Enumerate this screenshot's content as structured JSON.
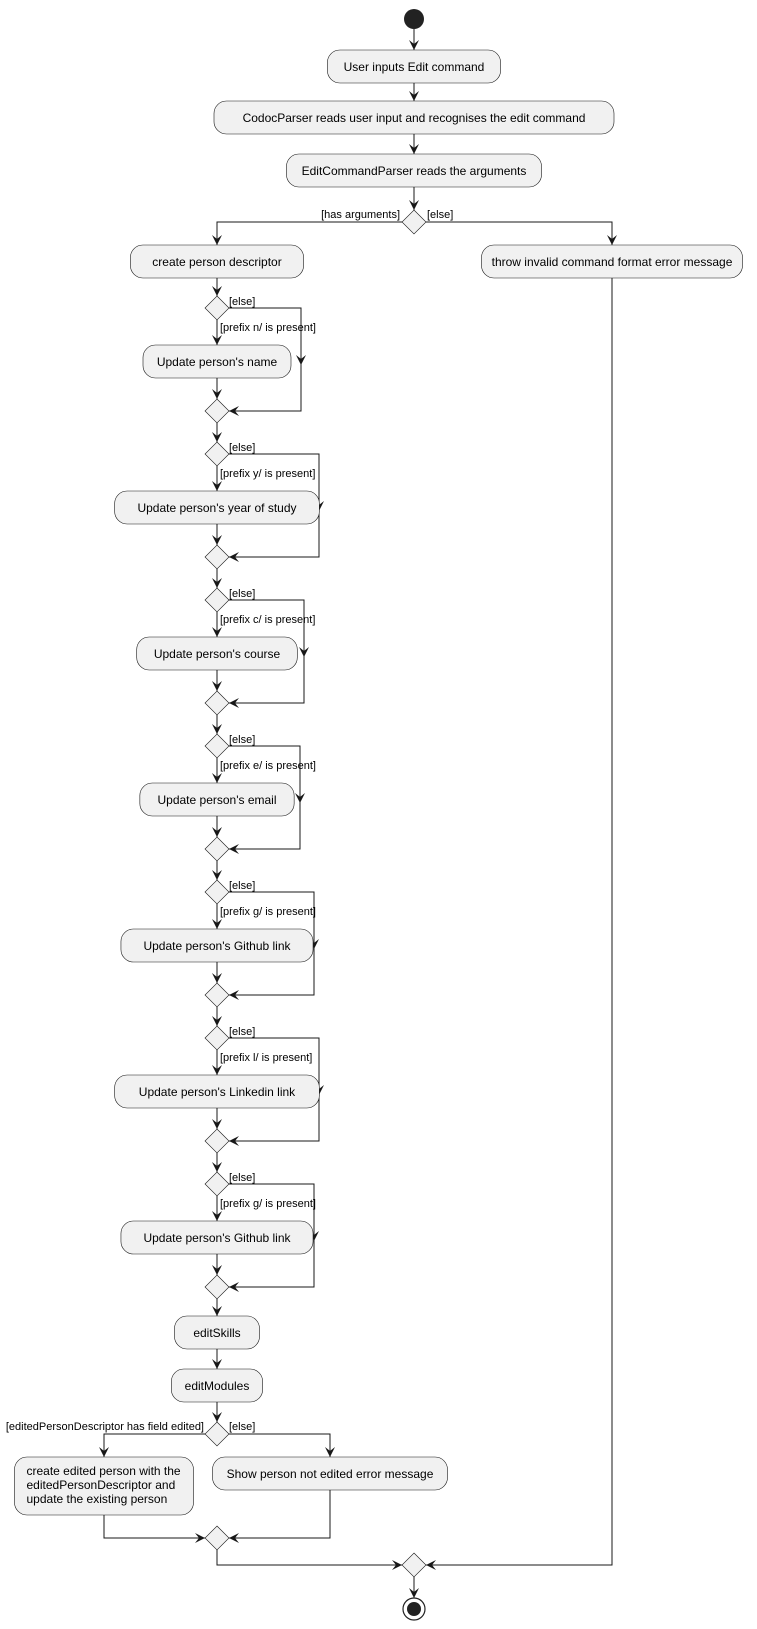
{
  "diagram": {
    "type": "UML activity diagram",
    "start_label": "start",
    "end_label": "stop",
    "actions": {
      "user_input": "User inputs Edit command",
      "codoc_parser": "CodocParser reads user input and recognises the edit command",
      "edit_parser": "EditCommandParser reads the arguments",
      "create_descriptor": "create person descriptor",
      "throw_error": "throw invalid command format error message",
      "edit_skills": "editSkills",
      "edit_modules": "editModules",
      "create_edited": [
        "create edited person with the",
        "editedPersonDescriptor and",
        "update the existing person"
      ],
      "not_edited": "Show person not edited error message"
    },
    "first_decision": {
      "yes_label": "[has arguments]",
      "no_label": "[else]"
    },
    "field_updates": [
      {
        "condition": "[prefix n/ is present]",
        "else_label": "[else]",
        "action": "Update person's name"
      },
      {
        "condition": "[prefix y/ is present]",
        "else_label": "[else]",
        "action": "Update person's year of study"
      },
      {
        "condition": "[prefix c/ is present]",
        "else_label": "[else]",
        "action": "Update person's course"
      },
      {
        "condition": "[prefix e/ is present]",
        "else_label": "[else]",
        "action": "Update person's email"
      },
      {
        "condition": "[prefix g/ is present]",
        "else_label": "[else]",
        "action": "Update person's Github link"
      },
      {
        "condition": "[prefix l/ is present]",
        "else_label": "[else]",
        "action": "Update person's Linkedin link"
      },
      {
        "condition": "[prefix g/ is present]",
        "else_label": "[else]",
        "action": "Update person's Github link"
      }
    ],
    "final_decision": {
      "yes_label": "[editedPersonDescriptor has field edited]",
      "no_label": "[else]"
    }
  },
  "colors": {
    "node_fill": "#f1f1f1",
    "stroke": "#181818",
    "background": "#ffffff"
  }
}
